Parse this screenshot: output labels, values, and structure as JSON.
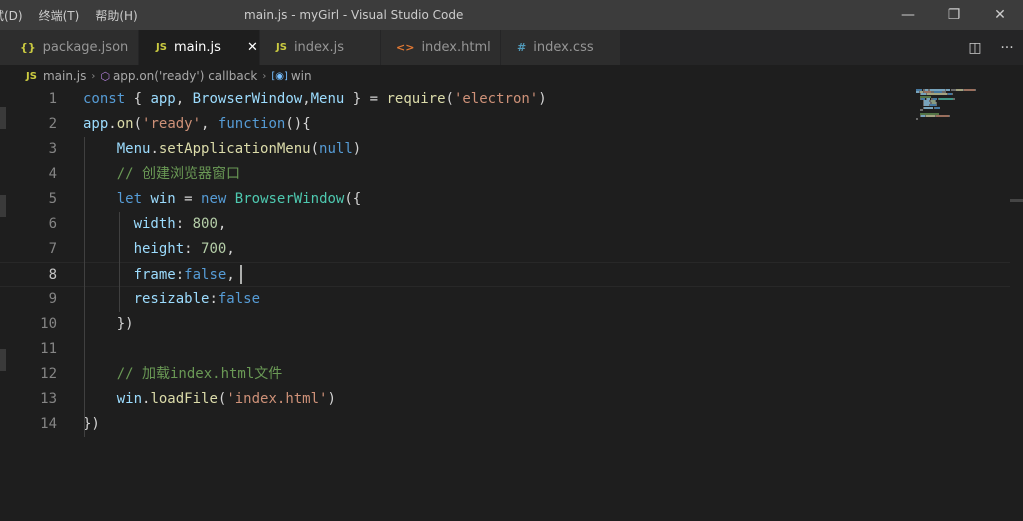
{
  "menu": [
    "试(D)",
    "终端(T)",
    "帮助(H)"
  ],
  "window_title": "main.js - myGirl - Visual Studio Code",
  "window_controls": {
    "minimize": "—",
    "maximize": "❐",
    "close": "✕"
  },
  "tabs": [
    {
      "icon": "{}",
      "label": "package.json"
    },
    {
      "icon": "JS",
      "label": "main.js",
      "close": "✕"
    },
    {
      "icon": "JS",
      "label": "index.js"
    },
    {
      "icon": "<>",
      "label": "index.html"
    },
    {
      "icon": "#",
      "label": "index.css"
    }
  ],
  "tab_actions": {
    "split": "◫",
    "more": "···"
  },
  "breadcrumb": {
    "file_icon": "JS",
    "file": "main.js",
    "symbol_icon": "⬡",
    "symbol": "app.on('ready') callback",
    "var_icon": "[◉]",
    "var": "win"
  },
  "editor": {
    "current_line": 8,
    "line_numbers": [
      "1",
      "2",
      "3",
      "4",
      "5",
      "6",
      "7",
      "8",
      "9",
      "10",
      "11",
      "12",
      "13",
      "14"
    ],
    "lines": [
      [
        [
          "kw",
          "const"
        ],
        [
          "pun",
          " { "
        ],
        [
          "var",
          "app"
        ],
        [
          "pun",
          ", "
        ],
        [
          "var",
          "BrowserWindow"
        ],
        [
          "pun",
          ","
        ],
        [
          "var",
          "Menu"
        ],
        [
          "pun",
          " } = "
        ],
        [
          "fn",
          "require"
        ],
        [
          "pun",
          "("
        ],
        [
          "str",
          "'electron'"
        ],
        [
          "pun",
          ")"
        ]
      ],
      [
        [
          "var",
          "app"
        ],
        [
          "pun",
          "."
        ],
        [
          "fn",
          "on"
        ],
        [
          "pun",
          "("
        ],
        [
          "str",
          "'ready'"
        ],
        [
          "pun",
          ", "
        ],
        [
          "kw",
          "function"
        ],
        [
          "pun",
          "(){"
        ]
      ],
      [
        [
          "pun",
          "    "
        ],
        [
          "var",
          "Menu"
        ],
        [
          "pun",
          "."
        ],
        [
          "fn",
          "setApplicationMenu"
        ],
        [
          "pun",
          "("
        ],
        [
          "kw",
          "null"
        ],
        [
          "pun",
          ")"
        ]
      ],
      [
        [
          "cmt",
          "    // 创建浏览器窗口"
        ]
      ],
      [
        [
          "pun",
          "    "
        ],
        [
          "kw",
          "let"
        ],
        [
          "pun",
          " "
        ],
        [
          "var",
          "win"
        ],
        [
          "pun",
          " = "
        ],
        [
          "kw",
          "new"
        ],
        [
          "pun",
          " "
        ],
        [
          "cls",
          "BrowserWindow"
        ],
        [
          "pun",
          "({"
        ]
      ],
      [
        [
          "pun",
          "      "
        ],
        [
          "var",
          "width"
        ],
        [
          "pun",
          ": "
        ],
        [
          "num",
          "800"
        ],
        [
          "pun",
          ","
        ]
      ],
      [
        [
          "pun",
          "      "
        ],
        [
          "var",
          "height"
        ],
        [
          "pun",
          ": "
        ],
        [
          "num",
          "700"
        ],
        [
          "pun",
          ","
        ]
      ],
      [
        [
          "pun",
          "      "
        ],
        [
          "var",
          "frame"
        ],
        [
          "pun",
          ":"
        ],
        [
          "kw",
          "false"
        ],
        [
          "pun",
          ","
        ]
      ],
      [
        [
          "pun",
          "      "
        ],
        [
          "var",
          "resizable"
        ],
        [
          "pun",
          ":"
        ],
        [
          "kw",
          "false"
        ]
      ],
      [
        [
          "pun",
          "    })"
        ]
      ],
      [],
      [
        [
          "cmt",
          "    // 加载index.html文件"
        ]
      ],
      [
        [
          "pun",
          "    "
        ],
        [
          "var",
          "win"
        ],
        [
          "pun",
          "."
        ],
        [
          "fn",
          "loadFile"
        ],
        [
          "pun",
          "("
        ],
        [
          "str",
          "'index.html'"
        ],
        [
          "pun",
          ")"
        ]
      ],
      [
        [
          "pun",
          "})"
        ]
      ]
    ]
  }
}
